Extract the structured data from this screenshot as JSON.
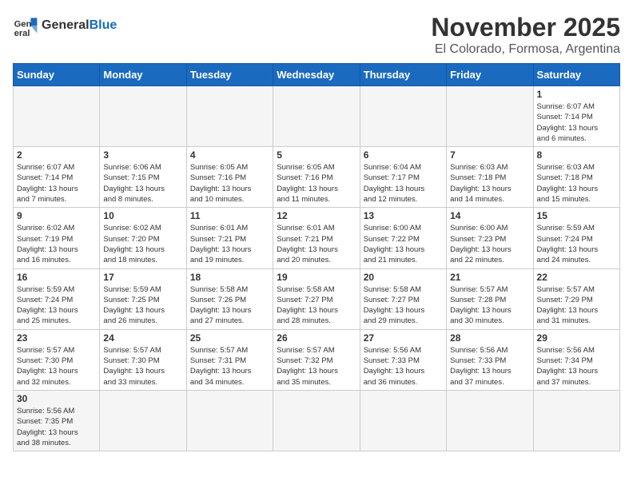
{
  "header": {
    "logo_general": "General",
    "logo_blue": "Blue",
    "title": "November 2025",
    "subtitle": "El Colorado, Formosa, Argentina"
  },
  "weekdays": [
    "Sunday",
    "Monday",
    "Tuesday",
    "Wednesday",
    "Thursday",
    "Friday",
    "Saturday"
  ],
  "weeks": [
    [
      {
        "day": "",
        "info": ""
      },
      {
        "day": "",
        "info": ""
      },
      {
        "day": "",
        "info": ""
      },
      {
        "day": "",
        "info": ""
      },
      {
        "day": "",
        "info": ""
      },
      {
        "day": "",
        "info": ""
      },
      {
        "day": "1",
        "info": "Sunrise: 6:07 AM\nSunset: 7:14 PM\nDaylight: 13 hours\nand 6 minutes."
      }
    ],
    [
      {
        "day": "2",
        "info": "Sunrise: 6:07 AM\nSunset: 7:14 PM\nDaylight: 13 hours\nand 7 minutes."
      },
      {
        "day": "3",
        "info": "Sunrise: 6:06 AM\nSunset: 7:15 PM\nDaylight: 13 hours\nand 8 minutes."
      },
      {
        "day": "4",
        "info": "Sunrise: 6:05 AM\nSunset: 7:16 PM\nDaylight: 13 hours\nand 10 minutes."
      },
      {
        "day": "5",
        "info": "Sunrise: 6:05 AM\nSunset: 7:16 PM\nDaylight: 13 hours\nand 11 minutes."
      },
      {
        "day": "6",
        "info": "Sunrise: 6:04 AM\nSunset: 7:17 PM\nDaylight: 13 hours\nand 12 minutes."
      },
      {
        "day": "7",
        "info": "Sunrise: 6:03 AM\nSunset: 7:18 PM\nDaylight: 13 hours\nand 14 minutes."
      },
      {
        "day": "8",
        "info": "Sunrise: 6:03 AM\nSunset: 7:18 PM\nDaylight: 13 hours\nand 15 minutes."
      }
    ],
    [
      {
        "day": "9",
        "info": "Sunrise: 6:02 AM\nSunset: 7:19 PM\nDaylight: 13 hours\nand 16 minutes."
      },
      {
        "day": "10",
        "info": "Sunrise: 6:02 AM\nSunset: 7:20 PM\nDaylight: 13 hours\nand 18 minutes."
      },
      {
        "day": "11",
        "info": "Sunrise: 6:01 AM\nSunset: 7:21 PM\nDaylight: 13 hours\nand 19 minutes."
      },
      {
        "day": "12",
        "info": "Sunrise: 6:01 AM\nSunset: 7:21 PM\nDaylight: 13 hours\nand 20 minutes."
      },
      {
        "day": "13",
        "info": "Sunrise: 6:00 AM\nSunset: 7:22 PM\nDaylight: 13 hours\nand 21 minutes."
      },
      {
        "day": "14",
        "info": "Sunrise: 6:00 AM\nSunset: 7:23 PM\nDaylight: 13 hours\nand 22 minutes."
      },
      {
        "day": "15",
        "info": "Sunrise: 5:59 AM\nSunset: 7:24 PM\nDaylight: 13 hours\nand 24 minutes."
      }
    ],
    [
      {
        "day": "16",
        "info": "Sunrise: 5:59 AM\nSunset: 7:24 PM\nDaylight: 13 hours\nand 25 minutes."
      },
      {
        "day": "17",
        "info": "Sunrise: 5:59 AM\nSunset: 7:25 PM\nDaylight: 13 hours\nand 26 minutes."
      },
      {
        "day": "18",
        "info": "Sunrise: 5:58 AM\nSunset: 7:26 PM\nDaylight: 13 hours\nand 27 minutes."
      },
      {
        "day": "19",
        "info": "Sunrise: 5:58 AM\nSunset: 7:27 PM\nDaylight: 13 hours\nand 28 minutes."
      },
      {
        "day": "20",
        "info": "Sunrise: 5:58 AM\nSunset: 7:27 PM\nDaylight: 13 hours\nand 29 minutes."
      },
      {
        "day": "21",
        "info": "Sunrise: 5:57 AM\nSunset: 7:28 PM\nDaylight: 13 hours\nand 30 minutes."
      },
      {
        "day": "22",
        "info": "Sunrise: 5:57 AM\nSunset: 7:29 PM\nDaylight: 13 hours\nand 31 minutes."
      }
    ],
    [
      {
        "day": "23",
        "info": "Sunrise: 5:57 AM\nSunset: 7:30 PM\nDaylight: 13 hours\nand 32 minutes."
      },
      {
        "day": "24",
        "info": "Sunrise: 5:57 AM\nSunset: 7:30 PM\nDaylight: 13 hours\nand 33 minutes."
      },
      {
        "day": "25",
        "info": "Sunrise: 5:57 AM\nSunset: 7:31 PM\nDaylight: 13 hours\nand 34 minutes."
      },
      {
        "day": "26",
        "info": "Sunrise: 5:57 AM\nSunset: 7:32 PM\nDaylight: 13 hours\nand 35 minutes."
      },
      {
        "day": "27",
        "info": "Sunrise: 5:56 AM\nSunset: 7:33 PM\nDaylight: 13 hours\nand 36 minutes."
      },
      {
        "day": "28",
        "info": "Sunrise: 5:56 AM\nSunset: 7:33 PM\nDaylight: 13 hours\nand 37 minutes."
      },
      {
        "day": "29",
        "info": "Sunrise: 5:56 AM\nSunset: 7:34 PM\nDaylight: 13 hours\nand 37 minutes."
      }
    ],
    [
      {
        "day": "30",
        "info": "Sunrise: 5:56 AM\nSunset: 7:35 PM\nDaylight: 13 hours\nand 38 minutes."
      },
      {
        "day": "",
        "info": ""
      },
      {
        "day": "",
        "info": ""
      },
      {
        "day": "",
        "info": ""
      },
      {
        "day": "",
        "info": ""
      },
      {
        "day": "",
        "info": ""
      },
      {
        "day": "",
        "info": ""
      }
    ]
  ]
}
